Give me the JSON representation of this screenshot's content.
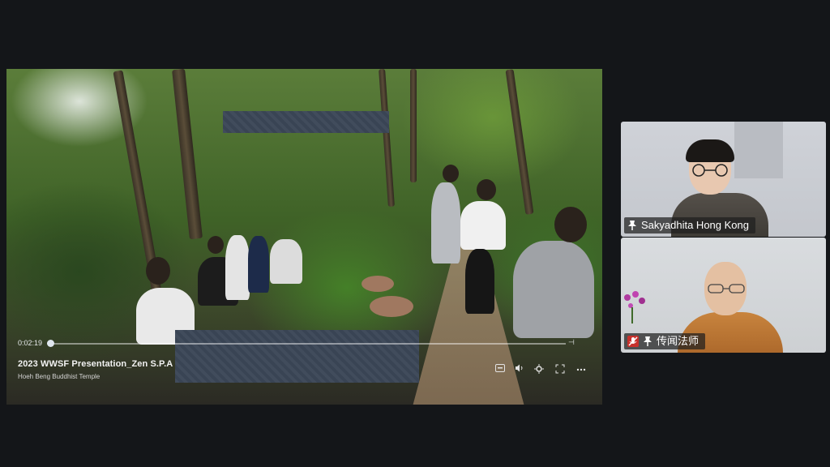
{
  "presentation": {
    "elapsed_time": "0:02:19",
    "title": "2023 WWSF Presentation_Zen S.P.A",
    "subtitle": "Hoeh Beng Buddhist Temple",
    "controls": [
      "captions-icon",
      "volume-icon",
      "settings-icon",
      "fullscreen-icon",
      "more-icon"
    ]
  },
  "participants": [
    {
      "name": "Sakyadhita Hong Kong",
      "pinned": true,
      "muted": false
    },
    {
      "name": "传闻法师",
      "pinned": true,
      "muted": true
    }
  ],
  "colors": {
    "background": "#141619",
    "redaction": "#3b4657",
    "namebar": "#1e1e1e",
    "muted_badge": "#c7302c"
  }
}
